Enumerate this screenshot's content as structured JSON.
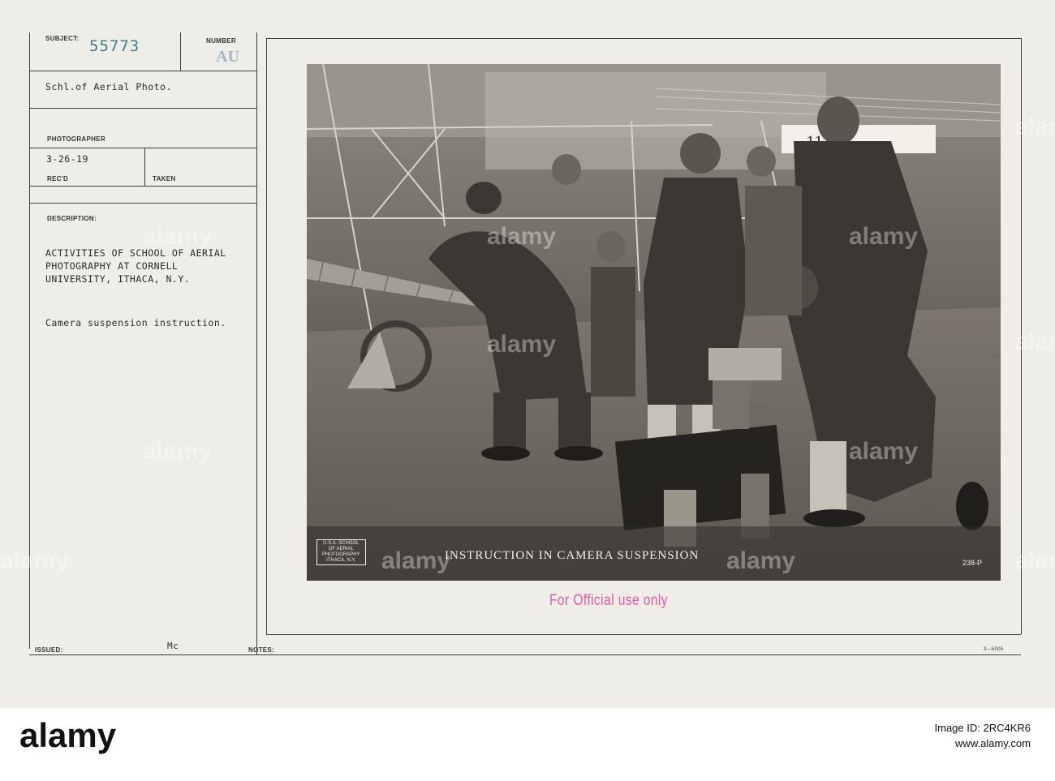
{
  "card": {
    "subject_label": "SUBJECT:",
    "subject_number": "55773",
    "number_label": "NUMBER",
    "number_stamp": "AU",
    "subject_text": "Schl.of Aerial Photo.",
    "photographer_label": "PHOTOGRAPHER",
    "date": "3-26-19",
    "recd_label": "REC'D",
    "taken_label": "TAKEN",
    "description_label": "DESCRIPTION:",
    "description_lines": [
      "ACTIVITIES OF SCHOOL OF AERIAL",
      "PHOTOGRAPHY AT CORNELL",
      "UNIVERSITY, ITHACA, N.Y."
    ],
    "note": "Camera suspension instruction.",
    "issued_label": "ISSUED:",
    "issued_initials": "Mc",
    "notes_label": "NOTES:",
    "form_code": "3—5005",
    "official_stamp": "For Official use only"
  },
  "photo": {
    "caption": "INSTRUCTION IN CAMERA SUSPENSION",
    "logo_lines": [
      "U.S.A. SCHOOL",
      "OF AERIAL",
      "PHOTOGRAPHY",
      "ITHACA, N.Y."
    ],
    "plate_number": "238-P",
    "sign_number": "11"
  },
  "watermarks": [
    "alamy",
    "alamy",
    "alamy",
    "alamy",
    "alamy",
    "alamy",
    "alamy",
    "alamy",
    "alamy",
    "alamy",
    "alamy",
    "alamy"
  ],
  "footer": {
    "brand": "alamy",
    "image_id": "Image ID: 2RC4KR6",
    "url": "www.alamy.com"
  }
}
